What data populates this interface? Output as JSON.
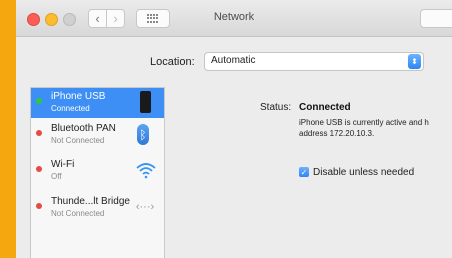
{
  "window": {
    "title": "Network",
    "nav": {
      "back_icon": "chevron-left-icon",
      "forward_icon": "chevron-right-icon",
      "show_all_icon": "grid-icon"
    }
  },
  "location": {
    "label": "Location:",
    "value": "Automatic"
  },
  "services": [
    {
      "name": "iPhone USB",
      "status": "Connected",
      "indicator": "green",
      "icon": "iphone-icon",
      "selected": true
    },
    {
      "name": "Bluetooth PAN",
      "status": "Not Connected",
      "indicator": "red",
      "icon": "bluetooth-icon",
      "selected": false
    },
    {
      "name": "Wi-Fi",
      "status": "Off",
      "indicator": "red",
      "icon": "wifi-icon",
      "selected": false
    },
    {
      "name": "Thunde...lt Bridge",
      "status": "Not Connected",
      "indicator": "red",
      "icon": "thunderbolt-bridge-icon",
      "selected": false
    }
  ],
  "detail": {
    "status_label": "Status:",
    "status_value": "Connected",
    "status_description": "iPhone USB is currently active and h address 172.20.10.3.",
    "checkbox_label": "Disable unless needed",
    "checkbox_checked": true
  },
  "colors": {
    "selection": "#3d8ef5",
    "connected": "#2dc93e",
    "not_connected": "#e64b45",
    "background": "#f5a70f"
  }
}
